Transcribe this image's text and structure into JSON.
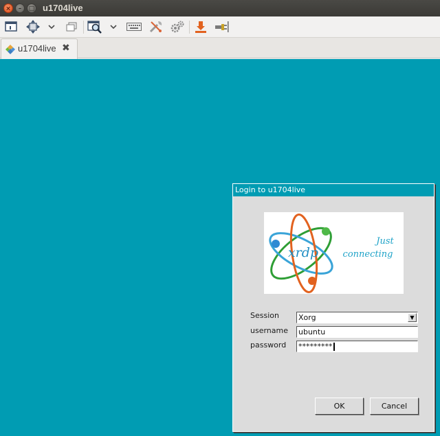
{
  "window": {
    "title": "u1704live",
    "buttons": {
      "close": "×",
      "minimize": "–",
      "maximize": "□"
    }
  },
  "toolbar": {
    "icons": [
      "connection-icon",
      "fit-window-icon",
      "chevron-down-icon",
      "window-stack-icon",
      "zoom-icon",
      "chevron-down-icon",
      "keyboard-icon",
      "tools-icon",
      "settings-gears-icon",
      "download-icon",
      "disconnect-icon"
    ]
  },
  "tab": {
    "label": "u1704live",
    "close": "✖"
  },
  "dialog": {
    "title": "Login to u1704live",
    "logo": {
      "brand": "xrdp",
      "tagline_line1": "Just",
      "tagline_line2": "connecting"
    },
    "session": {
      "label": "Session",
      "value": "Xorg",
      "arrow": "▼"
    },
    "username": {
      "label": "username",
      "value": "ubuntu"
    },
    "password": {
      "label": "password",
      "value": "*********"
    },
    "ok_label": "OK",
    "cancel_label": "Cancel"
  },
  "colors": {
    "remote_background": "#009cb3",
    "dialog_background": "#dcdcdc",
    "title_bar": "#3b3a36"
  }
}
